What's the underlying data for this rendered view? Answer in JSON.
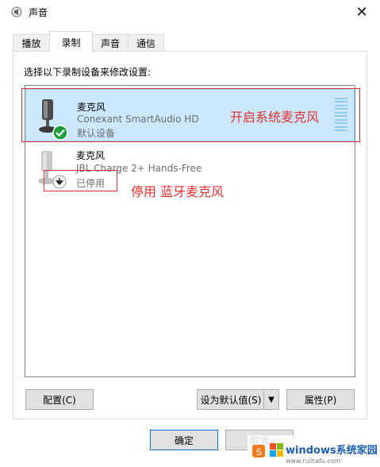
{
  "window": {
    "title": "声音",
    "close_glyph": "✕"
  },
  "tabs": [
    {
      "label": "播放",
      "active": false
    },
    {
      "label": "录制",
      "active": true
    },
    {
      "label": "声音",
      "active": false
    },
    {
      "label": "通信",
      "active": false
    }
  ],
  "instruction": "选择以下录制设备来修改设置:",
  "devices": [
    {
      "name": "麦克风",
      "description": "Conexant SmartAudio HD",
      "status": "默认设备",
      "selected": true,
      "badge": "check-icon"
    },
    {
      "name": "麦克风",
      "description": "JBL Charge 2+ Hands-Free",
      "status": "已停用",
      "selected": false,
      "badge": "disabled-arrow-icon"
    }
  ],
  "annotations": {
    "system_mic": "开启系统麦克风",
    "bluetooth_mic": "停用 蓝牙麦克风"
  },
  "buttons": {
    "configure": "配置(C)",
    "set_default": "设为默认值(S)",
    "properties": "属性(P)",
    "ok": "确定",
    "cancel": "取消"
  },
  "watermark": {
    "text": "windows系统家园",
    "url": "www.ruihafu.com"
  },
  "colors": {
    "selection": "#cce8ff",
    "annotation": "#e03030",
    "check": "#1e9e3a"
  }
}
